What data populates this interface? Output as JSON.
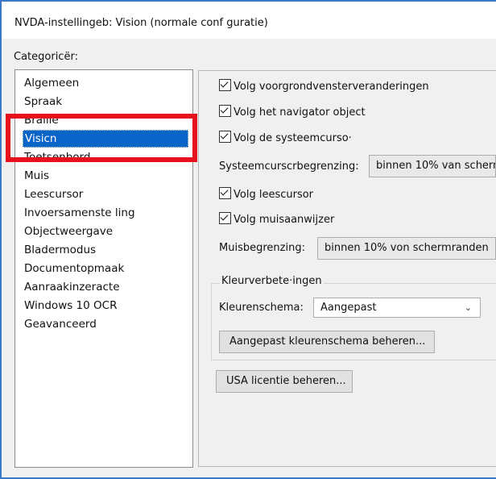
{
  "window": {
    "title": "NVDA-instellingeb: Vision (normale conf guratie)"
  },
  "categories": {
    "label": "Categoricër:",
    "items": [
      {
        "label": "Algemeen"
      },
      {
        "label": "Spraak"
      },
      {
        "label": "Braille"
      },
      {
        "label": "Visicn"
      },
      {
        "label": "Toetsenbord"
      },
      {
        "label": "Muis"
      },
      {
        "label": "Leescursor"
      },
      {
        "label": "Invoersamenste ling"
      },
      {
        "label": "Objectweergave"
      },
      {
        "label": "Bladermodus"
      },
      {
        "label": "Documentopmaak"
      },
      {
        "label": "Aanraakinzeracte"
      },
      {
        "label": "Windows 10 OCR"
      },
      {
        "label": "Geavanceerd"
      }
    ],
    "selected_index": 3
  },
  "vision": {
    "check_focus": {
      "label": "Volg voorgrondvensterveranderingen",
      "checked": true
    },
    "check_navigator": {
      "label": "Volg het navigator object",
      "checked": true
    },
    "check_syscursor": {
      "label": "Volg de systeemcurso·",
      "checked": true
    },
    "syscursor_limit": {
      "label": "Systeemcurscrbegrenzing:",
      "value": "binnen 10% van scherm"
    },
    "check_reviewcursor": {
      "label": "Volg leescursor",
      "checked": true
    },
    "check_mouse": {
      "label": "Volg muisaanwijzer",
      "checked": true
    },
    "mouse_limit": {
      "label": "Muisbegrenzing:",
      "value": "binnen 10% von schermranden"
    },
    "color_group": {
      "title": "Kleurverbete·ingen",
      "scheme_label": "Kleurenschema:",
      "scheme_value": "Aangepast",
      "manage_button": "Aangepast kleurenschema beheren..."
    },
    "license_button": "USA licentie beheren..."
  }
}
